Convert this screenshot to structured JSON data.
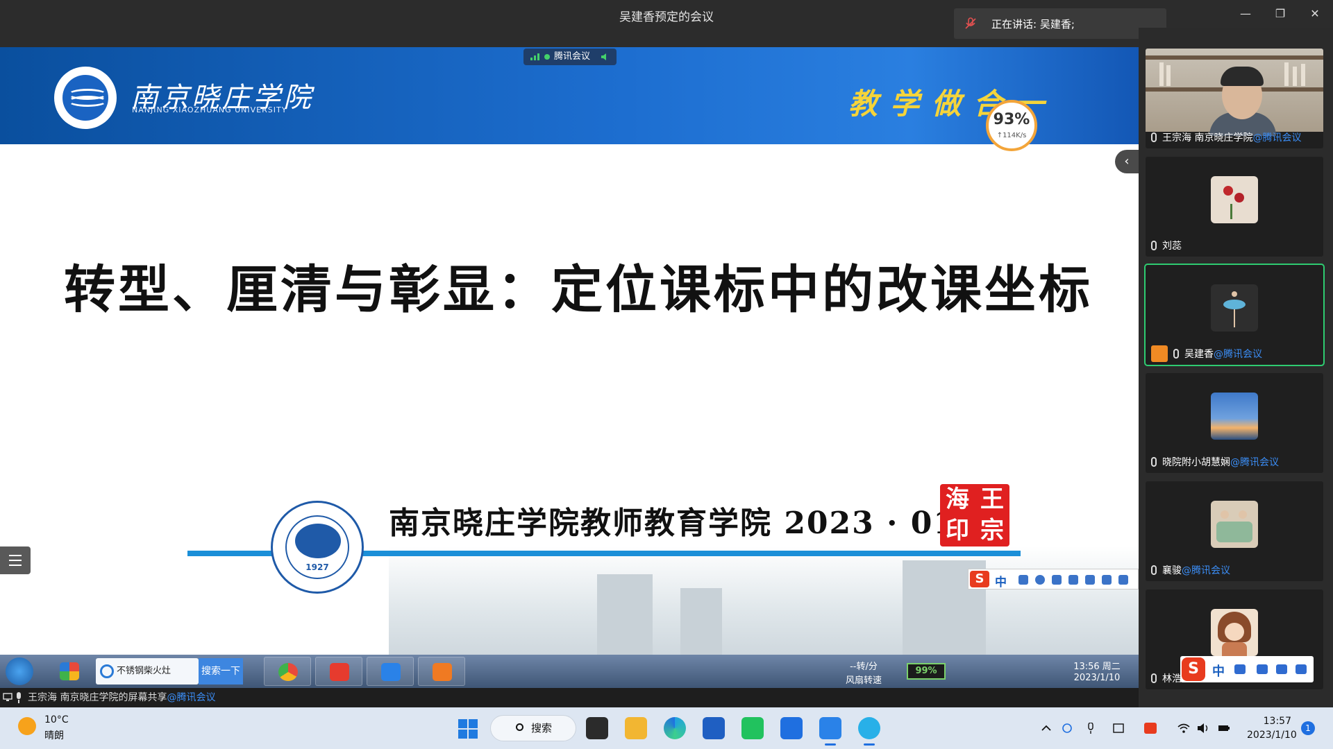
{
  "window": {
    "title": "吴建香预定的会议"
  },
  "speaking": {
    "label": "正在讲话: 吴建香;"
  },
  "window_controls": {
    "minimize": "—",
    "restore": "❐",
    "close": "✕"
  },
  "net_pill": {
    "label": "腾讯会议"
  },
  "perf": {
    "percent": "93%",
    "speed": "↑114K/s"
  },
  "slide": {
    "university_cn": "南京晓庄学院",
    "university_en": "NANJING XIAOZHUANG UNIVERSITY",
    "slogan": "教学做合一",
    "headline": "转型、厘清与彰显：定位课标中的改课坐标",
    "college": "南京晓庄学院教师教育学院 2023 · 01",
    "logo_year": "1927",
    "seal_chars": [
      "海",
      "王",
      "印",
      "宗"
    ],
    "ime_label": "中"
  },
  "collapse_icon": "‹",
  "remote_taskbar": {
    "ie_text": "不锈钢柴火灶",
    "search_button": "搜索一下",
    "fan_speed": "--转/分",
    "fan_label": "风扇转速",
    "battery": "99%",
    "time": "13:56 周二",
    "date": "2023/1/10"
  },
  "presenter": {
    "name": "王宗海 南京晓庄学院的屏幕共享",
    "tag": "@腾讯会议"
  },
  "participants": [
    {
      "name": "王宗海 南京晓庄学院",
      "tag": "@腾讯会议",
      "type": "video"
    },
    {
      "name": "刘蕊",
      "tag": "",
      "type": "avatar",
      "color": "#e8ddd0"
    },
    {
      "name": "吴建香",
      "tag": "@腾讯会议",
      "type": "avatar",
      "color": "#2e2e2e",
      "active": true
    },
    {
      "name": "晓院附小胡慧娴",
      "tag": "@腾讯会议",
      "type": "avatar",
      "color": "#3f79c9"
    },
    {
      "name": "襄骏",
      "tag": "@腾讯会议",
      "type": "avatar",
      "color": "#d9ccb8"
    },
    {
      "name": "林浩",
      "tag": "",
      "type": "avatar",
      "color": "#c97b52"
    }
  ],
  "ime_floating": {
    "label": "中"
  },
  "taskbar": {
    "temperature": "10°C",
    "condition": "晴朗",
    "search": "搜索",
    "time": "13:57",
    "date": "2023/1/10",
    "notifications": "1"
  },
  "colors": {
    "accent_blue": "#1f6fe0",
    "active_green": "#2ecc71",
    "seal_red": "#e02020",
    "banner_blue": "#1d6ed0"
  }
}
